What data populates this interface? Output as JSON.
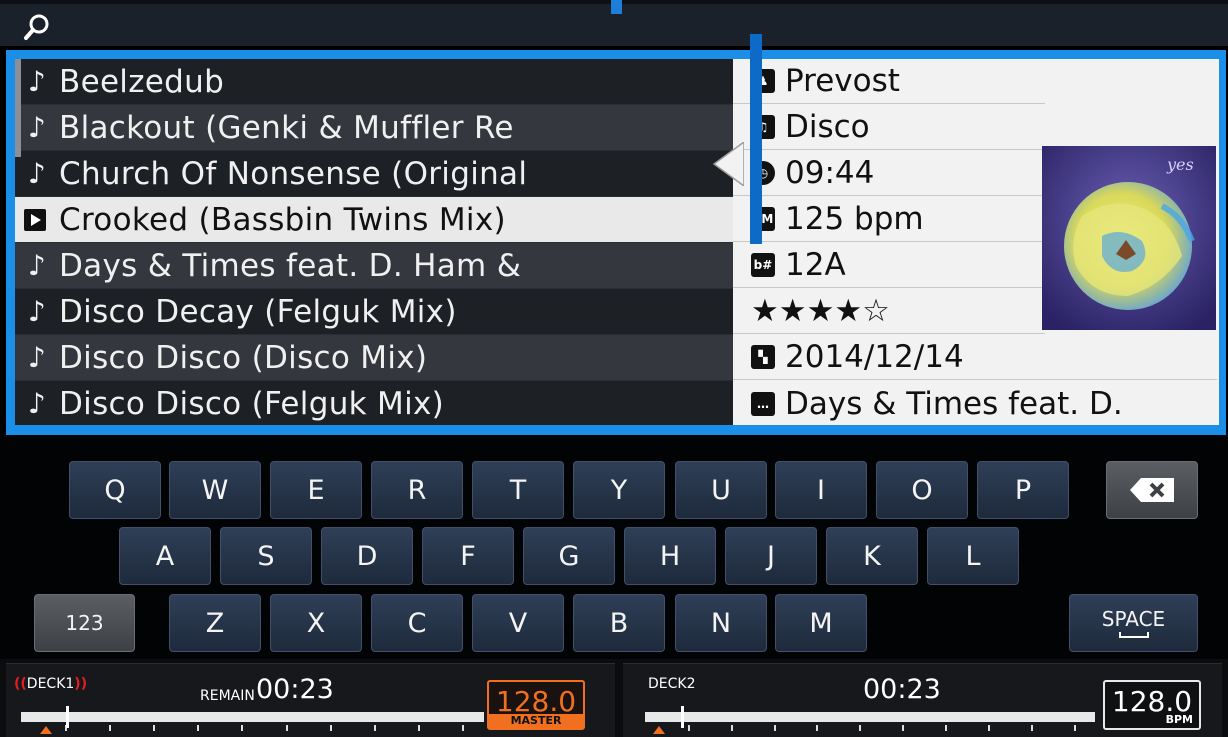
{
  "header": {
    "search_icon": "search-icon"
  },
  "tracks": [
    {
      "title": "Beelzedub",
      "icon": "music-note-icon",
      "selected": false
    },
    {
      "title": "Blackout (Genki & Muffler Re",
      "icon": "music-note-icon",
      "selected": false
    },
    {
      "title": "Church Of Nonsense (Original",
      "icon": "music-note-icon",
      "selected": false
    },
    {
      "title": "Crooked (Bassbin Twins Mix)",
      "icon": "play-icon",
      "selected": true
    },
    {
      "title": "Days & Times feat. D. Ham &",
      "icon": "music-note-icon",
      "selected": false
    },
    {
      "title": "Disco Decay (Felguk Mix)",
      "icon": "music-note-icon",
      "selected": false
    },
    {
      "title": "Disco Disco (Disco Mix)",
      "icon": "music-note-icon",
      "selected": false
    },
    {
      "title": "Disco Disco (Felguk Mix)",
      "icon": "music-note-icon",
      "selected": false
    }
  ],
  "track_info": {
    "artist": "Prevost",
    "genre": "Disco",
    "duration": "09:44",
    "bpm": "125 bpm",
    "key": "12A",
    "rating": "★★★★☆",
    "date": "2014/12/14",
    "comment": "Days & Times feat. D.",
    "icons": {
      "artist": "artist-icon",
      "genre": "genre-icon",
      "duration": "clock-icon",
      "bpm": "bpm-icon",
      "key": "key-icon",
      "date": "date-icon",
      "comment": "comment-icon"
    },
    "icon_text": {
      "bpm": "PM",
      "key": "b#"
    }
  },
  "keyboard": {
    "row1": [
      "Q",
      "W",
      "E",
      "R",
      "T",
      "Y",
      "U",
      "I",
      "O",
      "P"
    ],
    "row2": [
      "A",
      "S",
      "D",
      "F",
      "G",
      "H",
      "J",
      "K",
      "L"
    ],
    "row3": [
      "Z",
      "X",
      "C",
      "V",
      "B",
      "N",
      "M"
    ],
    "numbers_label": "123",
    "space_label": "SPACE",
    "backspace_icon": "backspace-icon",
    "backspace_glyph": "✕"
  },
  "deck1": {
    "label": "DECK1",
    "paren_left": "((",
    "paren_right": "))",
    "remain_label": "REMAIN",
    "time": "00:23",
    "bpm": "128.0",
    "bpm_sub": "MASTER",
    "accent": "#f07020",
    "progress": 0.02
  },
  "deck2": {
    "label": "DECK2",
    "time": "00:23",
    "bpm": "128.0",
    "bpm_sub": "BPM",
    "progress": 0.02
  },
  "colors": {
    "accent_blue": "#1b8ee8",
    "master_orange": "#f07020",
    "deck_paren_red": "#e02020"
  }
}
